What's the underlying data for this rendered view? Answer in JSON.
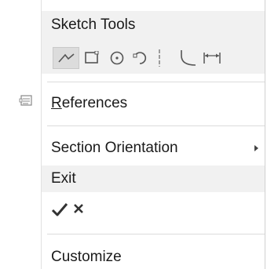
{
  "menu": {
    "sketch_tools": {
      "title": "Sketch Tools",
      "tools": [
        {
          "icon": "line-chain-icon",
          "selected": true
        },
        {
          "icon": "rectangle-icon"
        },
        {
          "icon": "circle-icon"
        },
        {
          "icon": "arc-icon"
        },
        {
          "icon": "centerline-icon"
        },
        {
          "icon": "fillet-curve-icon"
        },
        {
          "icon": "dimension-icon"
        }
      ]
    },
    "references": {
      "label_mnemonic": "R",
      "label_rest": "eferences",
      "icon": "references-icon"
    },
    "section_orientation": {
      "label": "Section Orientation",
      "has_submenu": true
    },
    "exit": {
      "title": "Exit",
      "actions": [
        {
          "icon": "checkmark-icon"
        },
        {
          "icon": "close-icon"
        }
      ]
    },
    "customize": {
      "label": "Customize"
    }
  },
  "colors": {
    "band": "#f1f1f1",
    "selected_tool": "#dcdcdc",
    "icon": "#555555"
  }
}
